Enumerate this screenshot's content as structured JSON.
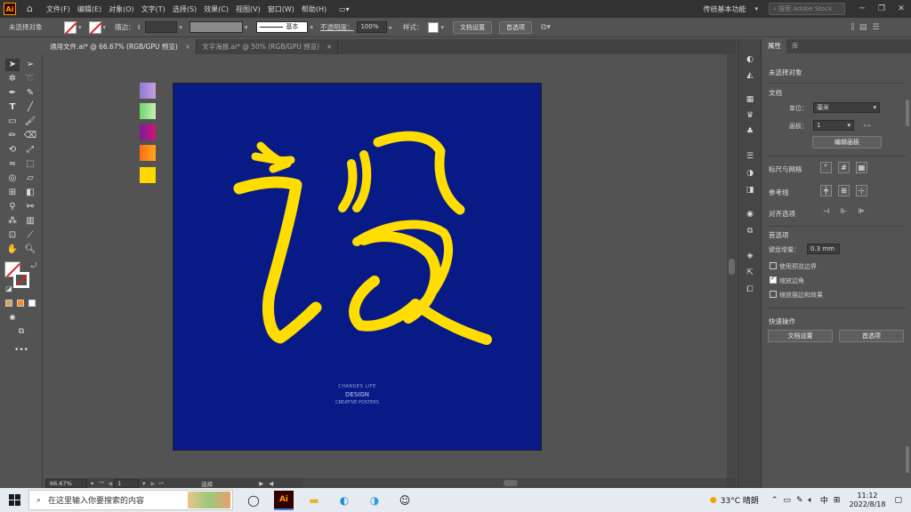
{
  "menubar": {
    "logo": "Ai",
    "items": [
      "文件(F)",
      "编辑(E)",
      "对象(O)",
      "文字(T)",
      "选择(S)",
      "效果(C)",
      "视图(V)",
      "窗口(W)",
      "帮助(H)"
    ],
    "workspace": "传统基本功能",
    "search_placeholder": "搜索 Adobe Stock"
  },
  "control_bar": {
    "selection_label": "未选择对象",
    "stroke_label": "描边：",
    "stroke_style": "基本",
    "opacity_label": "不透明度：",
    "opacity_value": "100%",
    "style_label": "样式：",
    "doc_setup": "文档设置",
    "preferences": "首选项"
  },
  "tabs": [
    {
      "label": "通用文件.ai* @ 66.67% (RGB/GPU 预览)",
      "close": "×"
    },
    {
      "label": "文字海报.ai* @ 50% (RGB/GPU 预览)",
      "close": "×"
    }
  ],
  "artwork": {
    "glyph": "设",
    "line1": "CHANGES LIFE",
    "line2": "DESIGN",
    "line3": "CREATIVE POSTERS",
    "artboard_color": "#071a86",
    "glyph_color": "#ffdd00"
  },
  "swatches": [
    "#9a86d6",
    "#8be08a",
    "#b0158c",
    "#ff8a1a",
    "#ffd800"
  ],
  "status": {
    "zoom": "66.67%",
    "page": "1",
    "tool": "选择"
  },
  "properties": {
    "tab_properties": "属性",
    "tab_layers": "库",
    "no_selection": "未选择对象",
    "document_title": "文档",
    "units_label": "单位：",
    "units_value": "毫米",
    "artboard_label": "画板：",
    "artboard_value": "1",
    "edit_artboards": "编辑画板",
    "rulers_grids": "标尺与网格",
    "guides": "参考线",
    "snap": "对齐选项",
    "prefs_title": "首选项",
    "keyboard_increment_label": "键盘增量：",
    "keyboard_increment_value": "0.3 mm",
    "use_preview_bounds": "使用预览边界",
    "scale_corners": "缩放边角",
    "scale_strokes": "缩放描边和效果",
    "quick_actions": "快速操作",
    "doc_setup_btn": "文档设置",
    "prefs_btn": "首选项"
  },
  "taskbar": {
    "search_placeholder": "在这里输入你要搜索的内容",
    "weather": "33°C 晴朗",
    "ime": "中",
    "time": "11:12",
    "date": "2022/8/18"
  }
}
